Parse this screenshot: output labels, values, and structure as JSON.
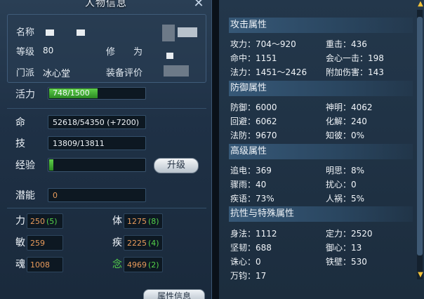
{
  "window": {
    "title": "人物信息",
    "close_glyph": "✕"
  },
  "profile": {
    "name_label": "名称",
    "level_label": "等级",
    "level_value": "80",
    "cultivation_label": "修　　为",
    "sect_label": "门派",
    "sect_value": "冰心堂",
    "gear_label": "装备评价"
  },
  "bars": {
    "vitality_label": "活力",
    "vitality_text": "748/1500",
    "vitality_fraction": 0.499,
    "life_label": "命",
    "life_text": "52618/54350 (+7200)",
    "skill_label": "技",
    "skill_text": "13809/13811",
    "exp_label": "经验",
    "exp_fraction": 0.04,
    "upgrade_label": "升级",
    "potential_label": "潜能",
    "potential_value": "0"
  },
  "stats": [
    {
      "label": "力",
      "value": "250",
      "bonus": "(5)"
    },
    {
      "label": "体",
      "value": "1275",
      "bonus": "(8)"
    },
    {
      "label": "敏",
      "value": "259",
      "bonus": ""
    },
    {
      "label": "疾",
      "value": "2225",
      "bonus": "(4)"
    },
    {
      "label": "魂",
      "value": "1008",
      "bonus": ""
    },
    {
      "label": "念",
      "value": "4969",
      "bonus": "(2)"
    }
  ],
  "attr_button": "属性信息",
  "sections": {
    "attack": {
      "title": "攻击属性",
      "items": [
        "攻力：704～920",
        "重击：436",
        "命中：1151",
        "会心一击：198",
        "法力：1451～2426",
        "附加伤害：143"
      ]
    },
    "defense": {
      "title": "防御属性",
      "items": [
        "防御：6000",
        "神明：4062",
        "回避：6062",
        "化解：240",
        "法防：9670",
        "知彼：0%"
      ]
    },
    "advanced": {
      "title": "高级属性",
      "items": [
        "追电：369",
        "明思：8%",
        "骤雨：40",
        "扰心：0",
        "疾语：73%",
        "人祸：5%"
      ]
    },
    "resist": {
      "title": "抗性与特殊属性",
      "items": [
        "身法：1112",
        "定力：2520",
        "坚韧：688",
        "御心：13",
        "诛心：0",
        "铁壁：530",
        "万钧：17"
      ]
    }
  },
  "colors": {
    "accent_orange": "#e89b5b",
    "bonus_green": "#54d24a",
    "bar_green": "#3fb233"
  },
  "icons": {
    "close": "close-icon",
    "scroll_up": "arrow-up-icon",
    "scroll_down": "arrow-down-icon"
  }
}
